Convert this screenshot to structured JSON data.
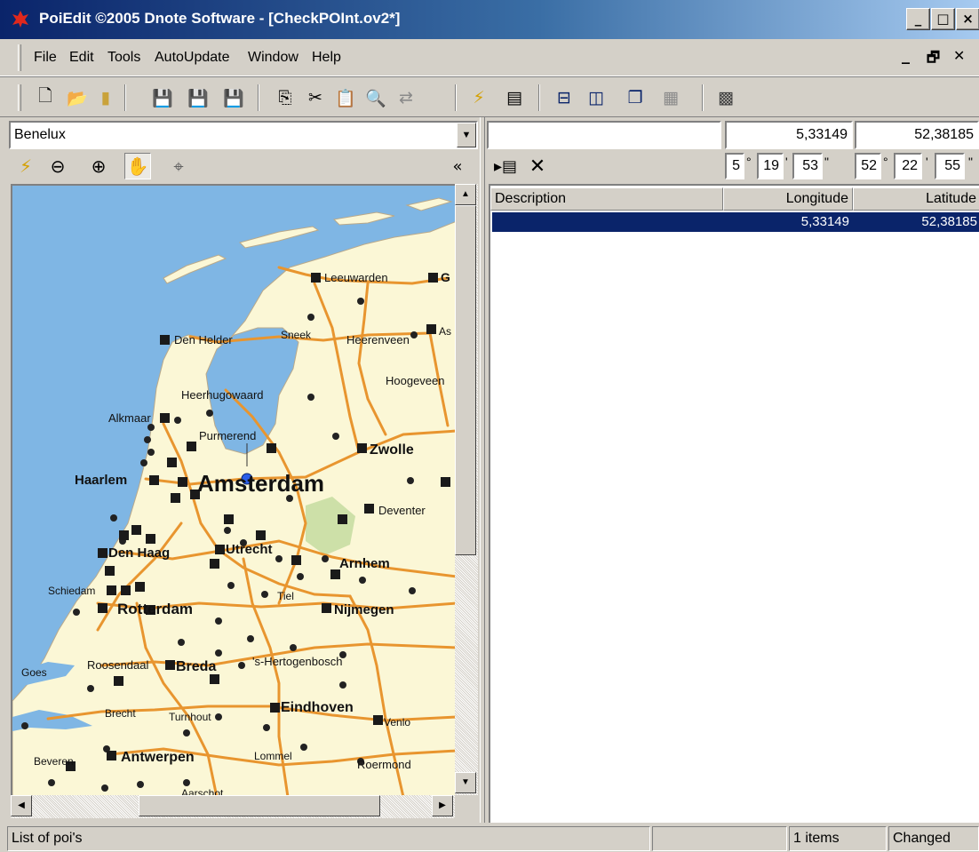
{
  "window": {
    "title": "PoiEdit ©2005 Dnote Software - [CheckPOInt.ov2*]",
    "controls": {
      "minimize": "_",
      "maximize": "□",
      "close": "×"
    }
  },
  "menu": {
    "items": [
      "File",
      "Edit",
      "Tools",
      "AutoUpdate",
      "Window",
      "Help"
    ],
    "mdi_controls": {
      "minimize": "_",
      "restore": "🗗",
      "close": "✕"
    }
  },
  "toolbar": {
    "buttons": [
      {
        "name": "new-file",
        "icon": "new-file-icon",
        "glyph": "🗋"
      },
      {
        "name": "open",
        "icon": "folder-open-icon",
        "glyph": "📂"
      },
      {
        "name": "gps-device",
        "icon": "gps-device-icon",
        "glyph": "▮"
      },
      {
        "name": "save",
        "icon": "save-icon",
        "glyph": "💾"
      },
      {
        "name": "save-as",
        "icon": "save-as-icon",
        "glyph": "💾"
      },
      {
        "name": "save-all",
        "icon": "save-all-icon",
        "glyph": "💾"
      },
      {
        "name": "copy",
        "icon": "copy-icon",
        "glyph": "⎘"
      },
      {
        "name": "cut",
        "icon": "scissors-icon",
        "glyph": "✂"
      },
      {
        "name": "paste",
        "icon": "paste-icon",
        "glyph": "📋"
      },
      {
        "name": "find",
        "icon": "magnifier-icon",
        "glyph": "🔍"
      },
      {
        "name": "replace",
        "icon": "replace-icon",
        "glyph": "⇄"
      },
      {
        "name": "update",
        "icon": "lightning-icon",
        "glyph": "⚡"
      },
      {
        "name": "properties",
        "icon": "properties-icon",
        "glyph": "▤"
      },
      {
        "name": "tile-horizontal",
        "icon": "tile-horizontal-icon",
        "glyph": "⊟"
      },
      {
        "name": "tile-vertical",
        "icon": "tile-vertical-icon",
        "glyph": "◫"
      },
      {
        "name": "cascade",
        "icon": "cascade-icon",
        "glyph": "❐"
      },
      {
        "name": "arrange",
        "icon": "arrange-icon",
        "glyph": "▦"
      },
      {
        "name": "calculator",
        "icon": "calculator-icon",
        "glyph": "▩"
      }
    ]
  },
  "map_panel": {
    "region_select": "Benelux",
    "tools": [
      {
        "name": "update",
        "icon": "lightning-icon",
        "glyph": "⚡"
      },
      {
        "name": "zoom-out",
        "icon": "zoom-out-icon",
        "glyph": "⊖"
      },
      {
        "name": "zoom-in",
        "icon": "zoom-in-icon",
        "glyph": "⊕"
      },
      {
        "name": "pan",
        "icon": "hand-icon",
        "glyph": "✋"
      },
      {
        "name": "crosshair",
        "icon": "crosshair-icon",
        "glyph": "⌖"
      }
    ],
    "collapse": "«",
    "cities": [
      {
        "label": "Leeuwarden",
        "bold": false
      },
      {
        "label": "Den Helder",
        "bold": false
      },
      {
        "label": "Sneek",
        "bold": false
      },
      {
        "label": "Heerenveen",
        "bold": false
      },
      {
        "label": "Hoogeveen",
        "bold": false
      },
      {
        "label": "Heerhugowaard",
        "bold": false
      },
      {
        "label": "Alkmaar",
        "bold": false
      },
      {
        "label": "Purmerend",
        "bold": false
      },
      {
        "label": "Zwolle",
        "bold": true
      },
      {
        "label": "Haarlem",
        "bold": true
      },
      {
        "label": "Amsterdam",
        "bold": true
      },
      {
        "label": "Deventer",
        "bold": false
      },
      {
        "label": "Den Haag",
        "bold": true
      },
      {
        "label": "Utrecht",
        "bold": true
      },
      {
        "label": "Arnhem",
        "bold": true
      },
      {
        "label": "Schiedam",
        "bold": false
      },
      {
        "label": "Tiel",
        "bold": false
      },
      {
        "label": "Rotterdam",
        "bold": true
      },
      {
        "label": "Nijmegen",
        "bold": true
      },
      {
        "label": "Goes",
        "bold": false
      },
      {
        "label": "Roosendaal",
        "bold": false
      },
      {
        "label": "Breda",
        "bold": true
      },
      {
        "label": "'s-Hertogenbosch",
        "bold": false
      },
      {
        "label": "Brecht",
        "bold": false
      },
      {
        "label": "Turnhout",
        "bold": false
      },
      {
        "label": "Eindhoven",
        "bold": true
      },
      {
        "label": "Venlo",
        "bold": false
      },
      {
        "label": "Beveren",
        "bold": false
      },
      {
        "label": "Antwerpen",
        "bold": true
      },
      {
        "label": "Lommel",
        "bold": false
      },
      {
        "label": "Roermond",
        "bold": false
      },
      {
        "label": "Aarschot",
        "bold": false
      },
      {
        "label": "G",
        "bold": true
      },
      {
        "label": "As",
        "bold": false
      }
    ]
  },
  "coords": {
    "search_value": "",
    "longitude": "5,33149",
    "latitude": "52,38185",
    "lon_deg": "5",
    "lon_min": "19",
    "lon_sec": "53",
    "lat_deg": "52",
    "lat_min": "22",
    "lat_sec": "55",
    "deg_sym": "°",
    "min_sym": "'",
    "sec_sym": "\""
  },
  "poi_actions": {
    "import_icon": "import-icon",
    "delete_icon": "delete-icon"
  },
  "list": {
    "columns": [
      "Description",
      "Longitude",
      "Latitude"
    ],
    "rows": [
      {
        "description": "",
        "longitude": "5,33149",
        "latitude": "52,38185",
        "selected": true
      }
    ]
  },
  "status": {
    "message": "List of poi's",
    "count": "1 items",
    "state": "Changed"
  },
  "colors": {
    "title_gradient_start": "#0a246a",
    "title_gradient_end": "#a6caf0",
    "selection": "#0a246a",
    "sea": "#7fb6e4",
    "land": "#fbf7d6",
    "road": "#e8952f"
  }
}
